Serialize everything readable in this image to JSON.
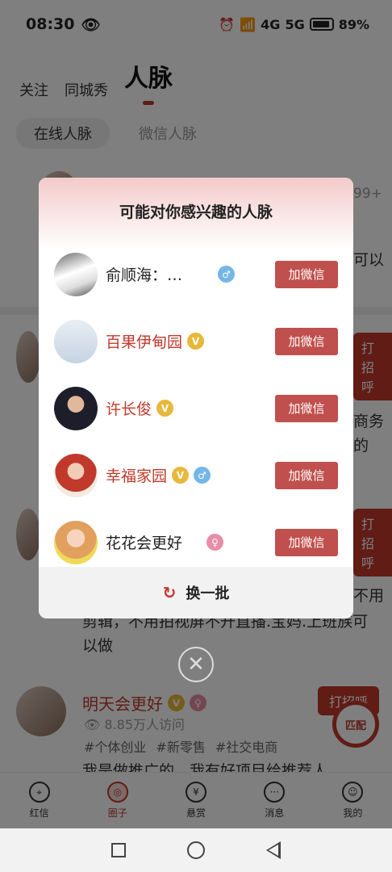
{
  "status": {
    "time": "08:30",
    "network": "4G",
    "network2": "5G",
    "battery": "89%"
  },
  "tabs": {
    "follow": "关注",
    "city": "同城秀",
    "network": "人脉"
  },
  "sub_tabs": {
    "online": "在线人脉",
    "wechat": "微信人脉"
  },
  "background": {
    "count_badge": "99+",
    "snippet1": "可以",
    "snippet2": "商务",
    "snippet3": "的",
    "greet": "打招呼",
    "snippet4": "不用",
    "line1": "剪辑，不用拍视屏不开直播.宝妈.上班族可",
    "line2": "以做",
    "post_name": "明天会更好",
    "post_visits": "8.85万人访问",
    "post_tags": [
      "#个体创业",
      "#新零售",
      "#社交电商"
    ],
    "post_body": "我是做推广的，我有好项目给推荐人"
  },
  "modal": {
    "title": "可能对你感兴趣的人脉",
    "refresh_label": "换一批",
    "people": [
      {
        "name": "俞顺海：…",
        "badges": [
          "male"
        ],
        "vip": false,
        "button": "加微信"
      },
      {
        "name": "百果伊甸园",
        "badges": [
          "v"
        ],
        "vip": true,
        "button": "加微信"
      },
      {
        "name": "许长俊",
        "badges": [
          "v"
        ],
        "vip": true,
        "button": "加微信"
      },
      {
        "name": "幸福家园",
        "badges": [
          "v",
          "male"
        ],
        "vip": true,
        "button": "加微信"
      },
      {
        "name": "花花会更好",
        "badges": [
          "female"
        ],
        "vip": false,
        "button": "加微信"
      }
    ]
  },
  "match_label": "匹配",
  "bottom_nav": [
    {
      "label": "红信",
      "icon": "location-icon"
    },
    {
      "label": "圈子",
      "icon": "circle-icon",
      "active": true
    },
    {
      "label": "悬赏",
      "icon": "bag-icon"
    },
    {
      "label": "消息",
      "icon": "chat-icon"
    },
    {
      "label": "我的",
      "icon": "user-icon"
    }
  ]
}
